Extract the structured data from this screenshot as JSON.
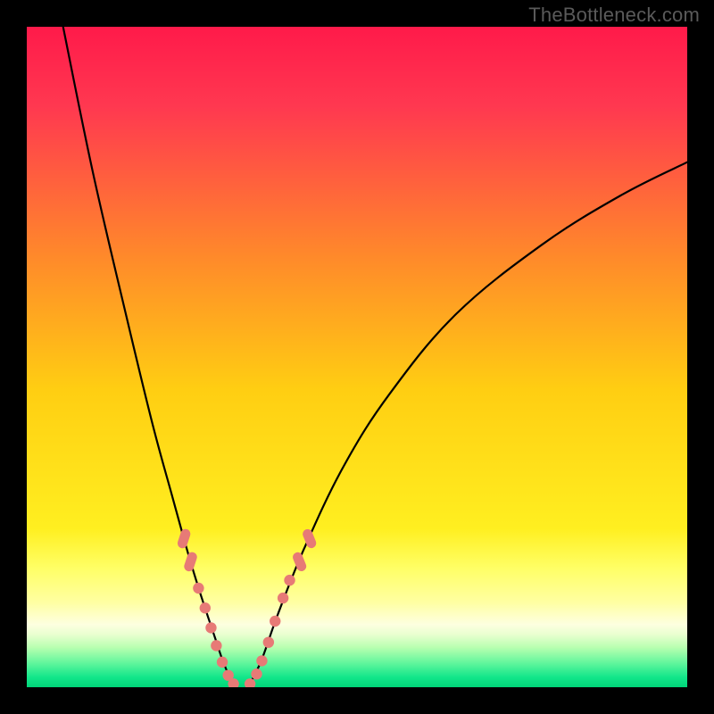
{
  "watermark": "TheBottleneck.com",
  "colors": {
    "gradient_top": "#ff1a4a",
    "gradient_mid": "#ffd400",
    "gradient_low_band": "#ffff88",
    "gradient_bottom_band": "#00e676",
    "curve": "#000000",
    "marker": "#e77a76",
    "frame": "#000000"
  },
  "chart_data": {
    "type": "line",
    "title": "",
    "xlabel": "",
    "ylabel": "",
    "xlim": [
      0,
      1
    ],
    "ylim": [
      0,
      1
    ],
    "series": [
      {
        "name": "left-branch",
        "x": [
          0.055,
          0.1,
          0.15,
          0.19,
          0.22,
          0.245,
          0.265,
          0.285,
          0.295,
          0.305,
          0.315
        ],
        "y": [
          1.0,
          0.78,
          0.565,
          0.4,
          0.29,
          0.2,
          0.135,
          0.075,
          0.045,
          0.02,
          0.0
        ]
      },
      {
        "name": "right-branch",
        "x": [
          0.335,
          0.355,
          0.38,
          0.42,
          0.48,
          0.55,
          0.65,
          0.78,
          0.9,
          1.0
        ],
        "y": [
          0.0,
          0.04,
          0.11,
          0.21,
          0.335,
          0.445,
          0.565,
          0.67,
          0.745,
          0.795
        ]
      }
    ],
    "markers": {
      "left": [
        {
          "x": 0.238,
          "y": 0.225,
          "shape": "pill"
        },
        {
          "x": 0.248,
          "y": 0.19,
          "shape": "pill"
        },
        {
          "x": 0.26,
          "y": 0.15,
          "shape": "dot"
        },
        {
          "x": 0.27,
          "y": 0.12,
          "shape": "dot"
        },
        {
          "x": 0.279,
          "y": 0.09,
          "shape": "dot"
        },
        {
          "x": 0.287,
          "y": 0.063,
          "shape": "dot"
        },
        {
          "x": 0.296,
          "y": 0.038,
          "shape": "dot"
        },
        {
          "x": 0.305,
          "y": 0.018,
          "shape": "dot"
        },
        {
          "x": 0.313,
          "y": 0.005,
          "shape": "dot"
        }
      ],
      "right": [
        {
          "x": 0.338,
          "y": 0.005,
          "shape": "dot"
        },
        {
          "x": 0.348,
          "y": 0.02,
          "shape": "dot"
        },
        {
          "x": 0.356,
          "y": 0.04,
          "shape": "dot"
        },
        {
          "x": 0.366,
          "y": 0.068,
          "shape": "dot"
        },
        {
          "x": 0.376,
          "y": 0.1,
          "shape": "dot"
        },
        {
          "x": 0.388,
          "y": 0.135,
          "shape": "dot"
        },
        {
          "x": 0.398,
          "y": 0.162,
          "shape": "dot"
        },
        {
          "x": 0.413,
          "y": 0.19,
          "shape": "pill"
        },
        {
          "x": 0.428,
          "y": 0.225,
          "shape": "pill"
        }
      ]
    },
    "gradient_stops": [
      {
        "offset": 0.0,
        "color": "#ff1a4a"
      },
      {
        "offset": 0.12,
        "color": "#ff3850"
      },
      {
        "offset": 0.35,
        "color": "#ff8a2a"
      },
      {
        "offset": 0.55,
        "color": "#ffce12"
      },
      {
        "offset": 0.76,
        "color": "#ffef20"
      },
      {
        "offset": 0.82,
        "color": "#ffff66"
      },
      {
        "offset": 0.87,
        "color": "#ffffa0"
      },
      {
        "offset": 0.905,
        "color": "#fdffe0"
      },
      {
        "offset": 0.92,
        "color": "#e9ffd0"
      },
      {
        "offset": 0.94,
        "color": "#b8ffb0"
      },
      {
        "offset": 0.965,
        "color": "#5bf59b"
      },
      {
        "offset": 0.985,
        "color": "#12e68a"
      },
      {
        "offset": 1.0,
        "color": "#00d478"
      }
    ]
  }
}
